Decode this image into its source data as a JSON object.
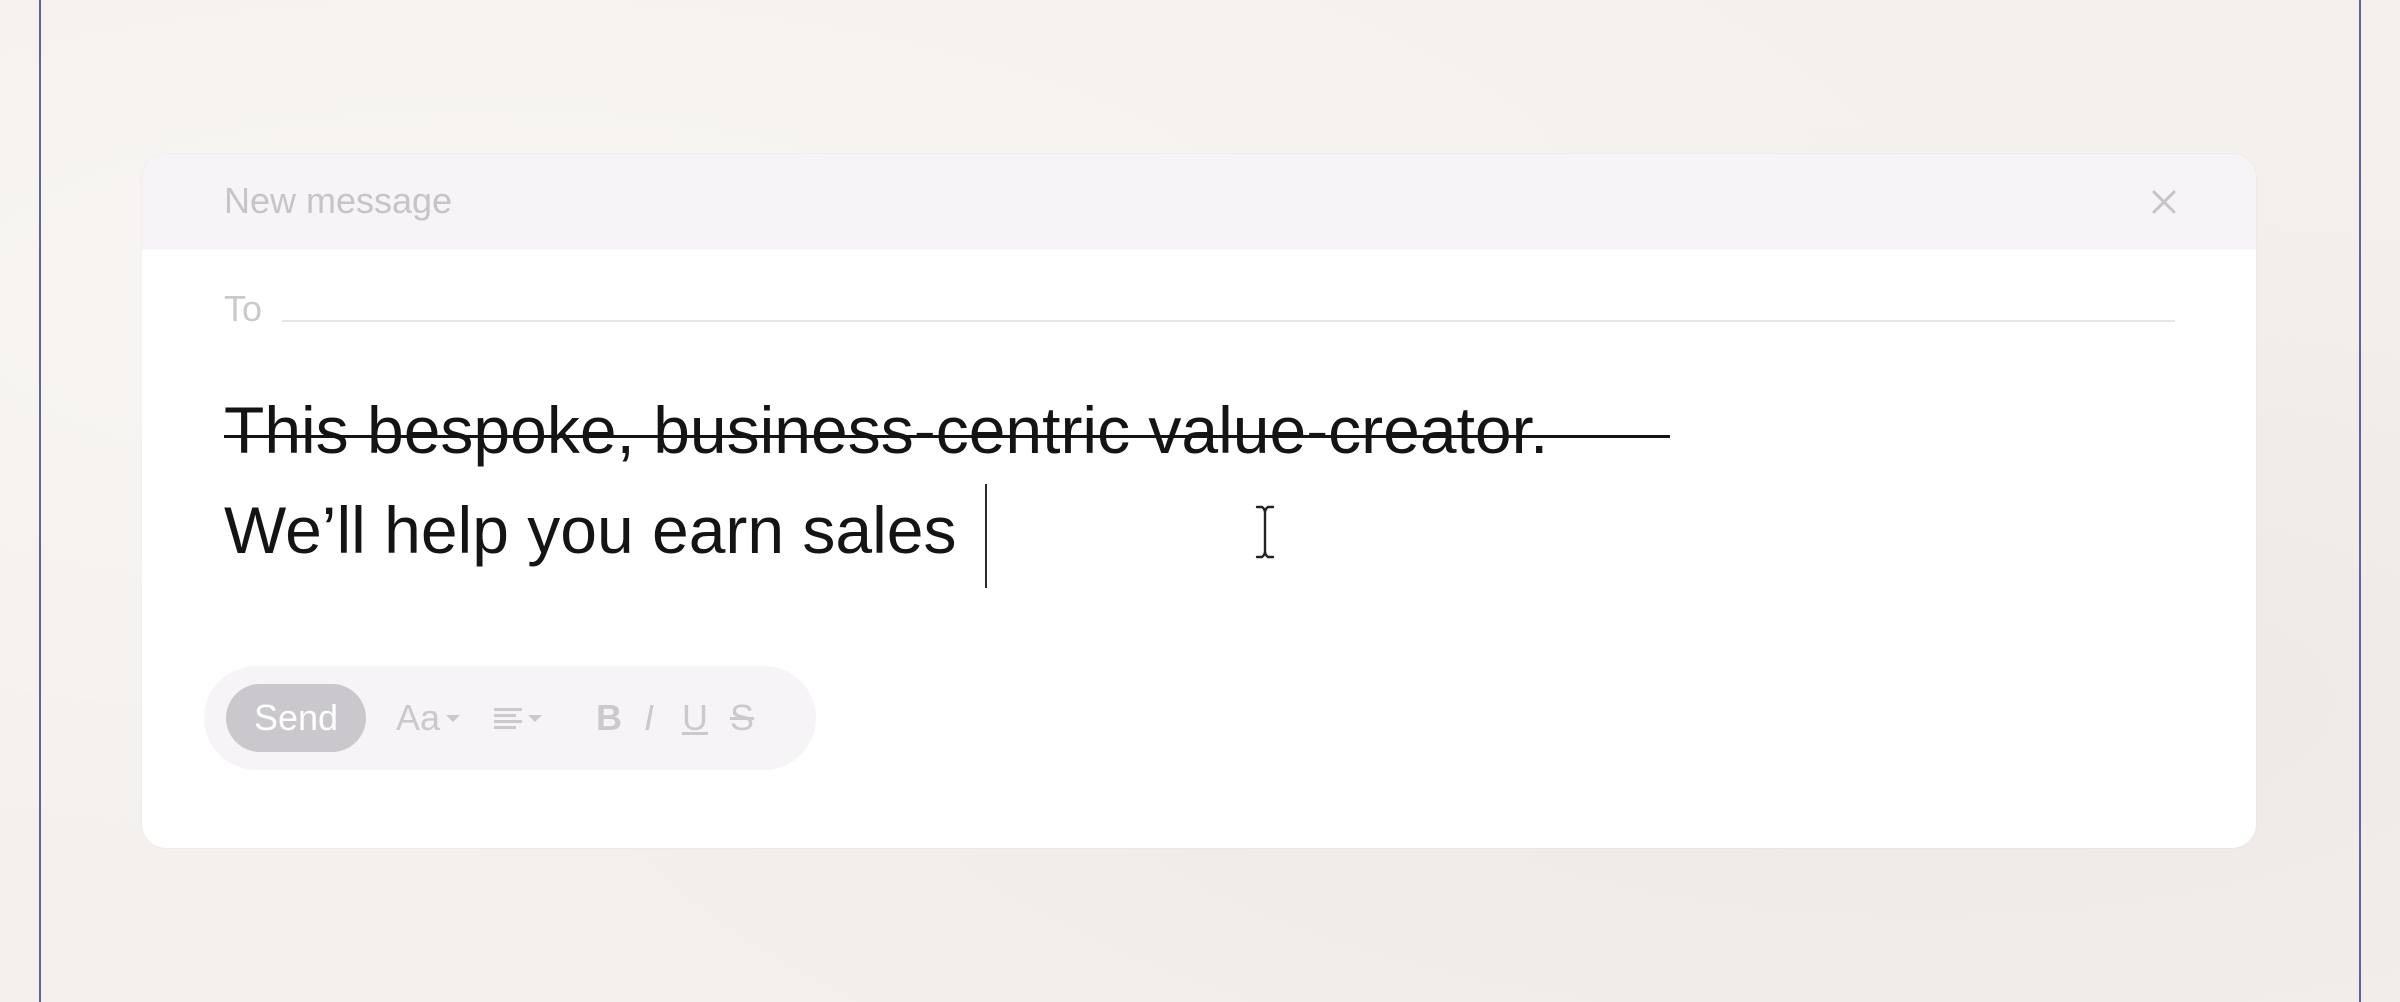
{
  "compose": {
    "title": "New message",
    "to_label": "To",
    "to_value": "",
    "body": {
      "line1": "This bespoke, business-centric value-creator.",
      "line2": "We’ll help you earn sales"
    }
  },
  "toolbar": {
    "send_label": "Send",
    "font_label": "Aa",
    "bold_label": "B",
    "italic_label": "I",
    "underline_label": "U",
    "strike_label": "S"
  },
  "icons": {
    "close": "close-icon",
    "align": "align-text-icon",
    "cursor": "text-cursor-icon"
  },
  "colors": {
    "guide": "#5d63a6",
    "header_bg": "#f6f4f6",
    "send_bg": "#cac8cc",
    "muted_text": "#c6c4ca",
    "body_text": "#141414"
  }
}
